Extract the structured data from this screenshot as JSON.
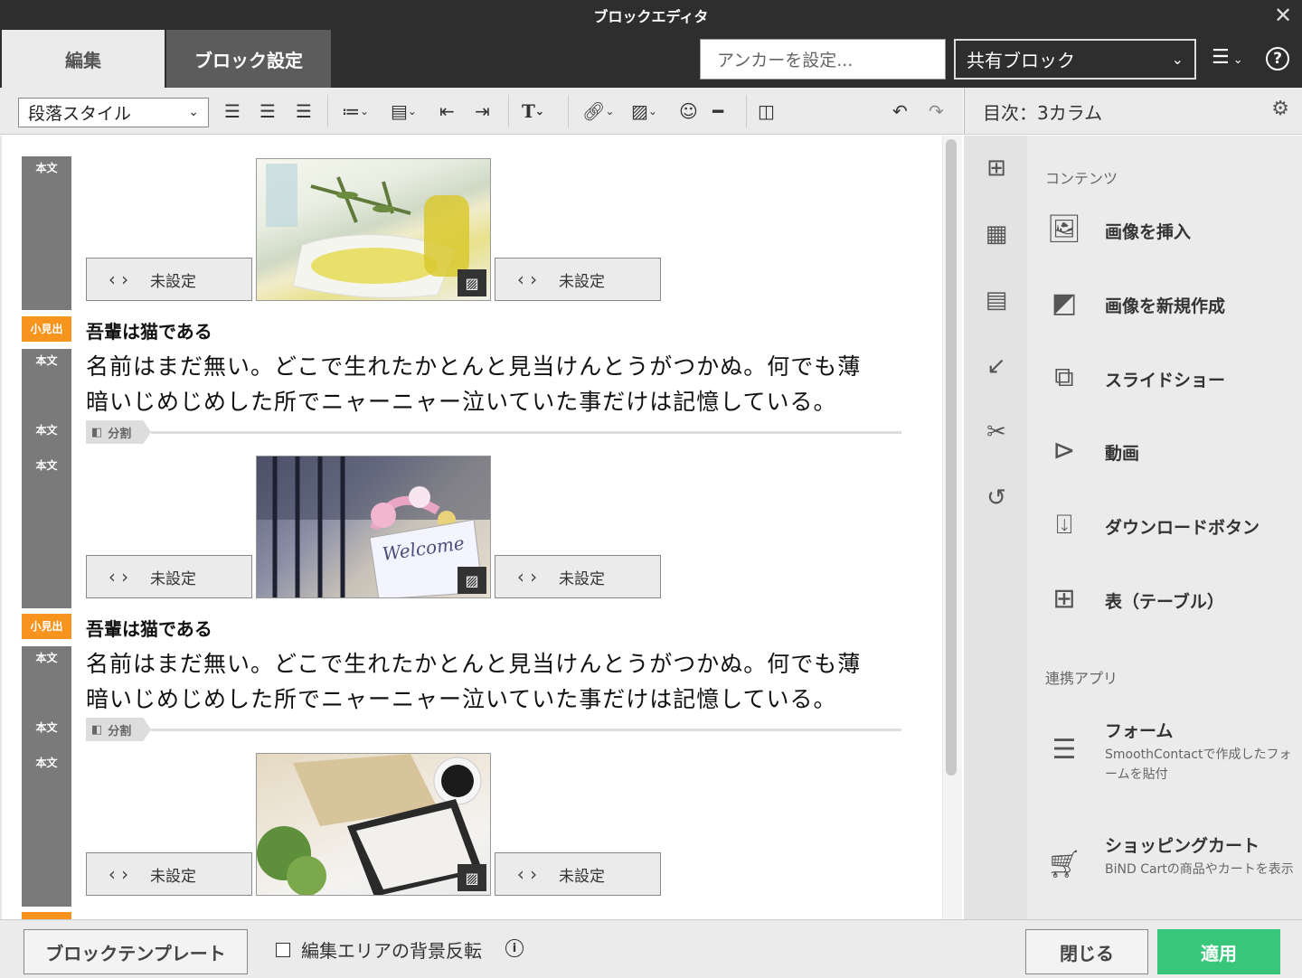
{
  "window": {
    "title": "ブロックエディタ"
  },
  "tabs": {
    "edit": "編集",
    "block_settings": "ブロック設定"
  },
  "anchor": {
    "placeholder": "アンカーを設定..."
  },
  "shared_block": {
    "value": "共有ブロック"
  },
  "toolbar": {
    "paragraph_style": "段落スタイル"
  },
  "sidebar": {
    "title": "目次：3カラム",
    "sections": {
      "contents": "コンテンツ",
      "apps": "連携アプリ"
    },
    "items": [
      {
        "label": "画像を挿入",
        "icon": "image-icon"
      },
      {
        "label": "画像を新規作成",
        "icon": "shapes-icon"
      },
      {
        "label": "スライドショー",
        "icon": "slideshow-icon"
      },
      {
        "label": "動画",
        "icon": "video-icon"
      },
      {
        "label": "ダウンロードボタン",
        "icon": "download-icon"
      },
      {
        "label": "表（テーブル）",
        "icon": "table-icon"
      }
    ],
    "apps": [
      {
        "label": "フォーム",
        "desc": "SmoothContactで作成したフォームを貼付",
        "icon": "form-icon"
      },
      {
        "label": "ショッピングカート",
        "desc": "BiND Cartの商品やカートを表示",
        "icon": "cart-icon"
      }
    ]
  },
  "editor": {
    "labels": {
      "body": "本文",
      "subheading": "小見出",
      "divider": "分割"
    },
    "link_placeholder": "未設定",
    "heading": "吾輩は猫である",
    "body_line1": "名前はまだ無い。どこで生れたかとんと見当けんとうがつかぬ。何でも薄",
    "body_line2": "暗いじめじめした所でニャーニャー泣いていた事だけは記憶している。",
    "photos": [
      "olive-oil-photo",
      "welcome-wedding-photo",
      "notebook-coffee-photo"
    ]
  },
  "footer": {
    "template_button": "ブロックテンプレート",
    "invert_bg_label": "編集エリアの背景反転",
    "close_button": "閉じる",
    "apply_button": "適用"
  }
}
